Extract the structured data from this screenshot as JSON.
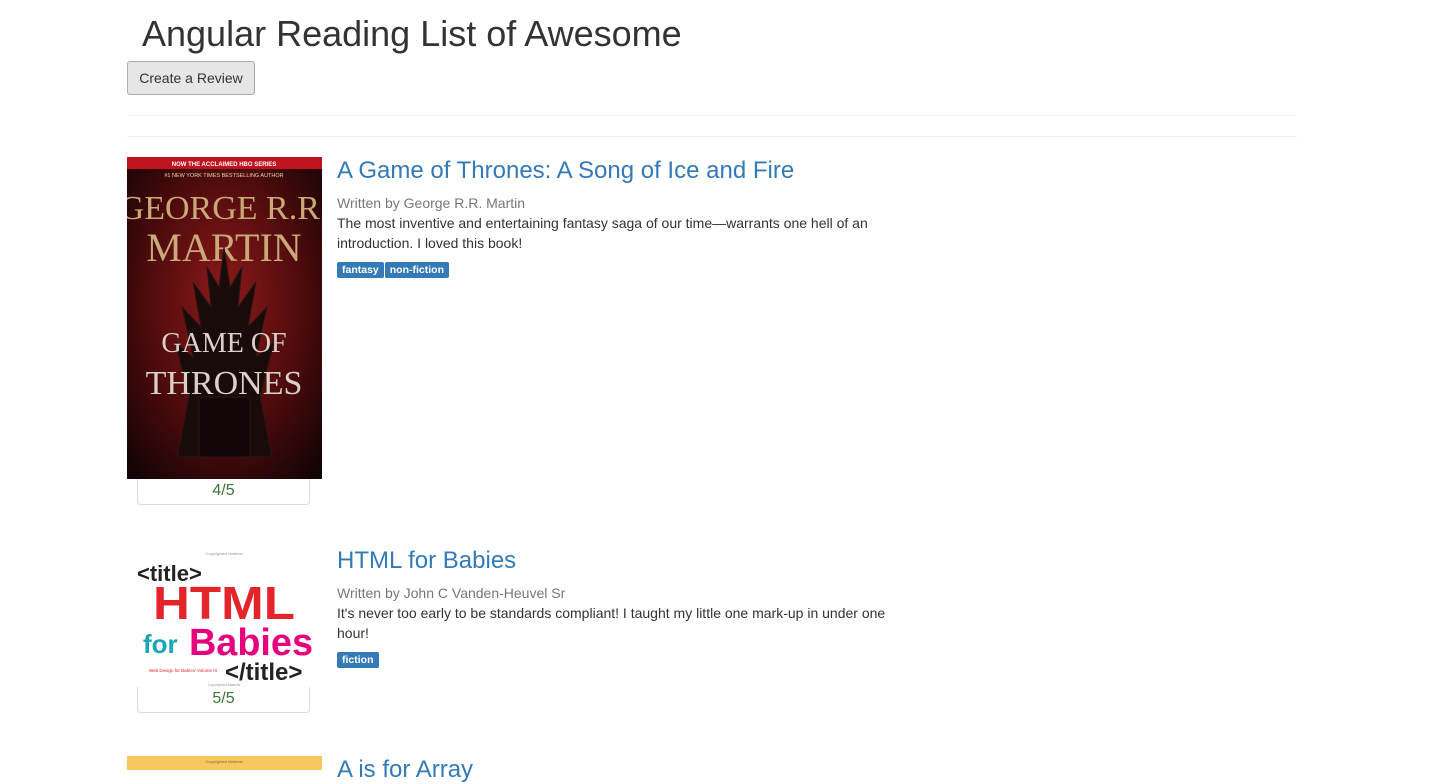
{
  "header": {
    "title": "Angular Reading List of Awesome",
    "create_button_label": "Create a Review"
  },
  "books": [
    {
      "title": "A Game of Thrones: A Song of Ice and Fire",
      "author_line": "Written by George R.R. Martin",
      "review": "The most inventive and entertaining fantasy saga of our time—warrants one hell of an introduction. I loved this book!",
      "tags": [
        "fantasy",
        "non-fiction"
      ],
      "rating": "4/5",
      "cover": {
        "banner": "NOW THE ACCLAIMED HBO SERIES",
        "subbanner": "#1 NEW YORK TIMES BESTSELLING AUTHOR",
        "author_first": "GEORGE R.R.",
        "author_last": "MARTIN",
        "title_line1": "GAME OF",
        "title_line2": "THRONES"
      }
    },
    {
      "title": "HTML for Babies",
      "author_line": "Written by John C Vanden-Heuvel Sr",
      "review": "It's never too early to be standards compliant! I taught my little one mark-up in under one hour!",
      "tags": [
        "fiction"
      ],
      "rating": "5/5",
      "cover": {
        "top_note": "Copyrighted Material",
        "open_tag": "<title>",
        "html_word": "HTML",
        "for_word": "for",
        "babies_word": "Babies",
        "close_tag": "</title>",
        "series": "Web Design for Babies' Volume III",
        "bottom_note": "Copyrighted Material"
      }
    },
    {
      "title": "A is for Array",
      "cover": {
        "top_note": "Copyrighted Material"
      }
    }
  ],
  "colors": {
    "link": "#337ab7",
    "rating": "#3c763d",
    "label_bg": "#337ab7",
    "got_red": "#c0121e",
    "html_red": "#e3242b",
    "babies_pink": "#e6007e",
    "for_teal": "#1aa6b7",
    "array_yellow": "#f6c85f"
  }
}
